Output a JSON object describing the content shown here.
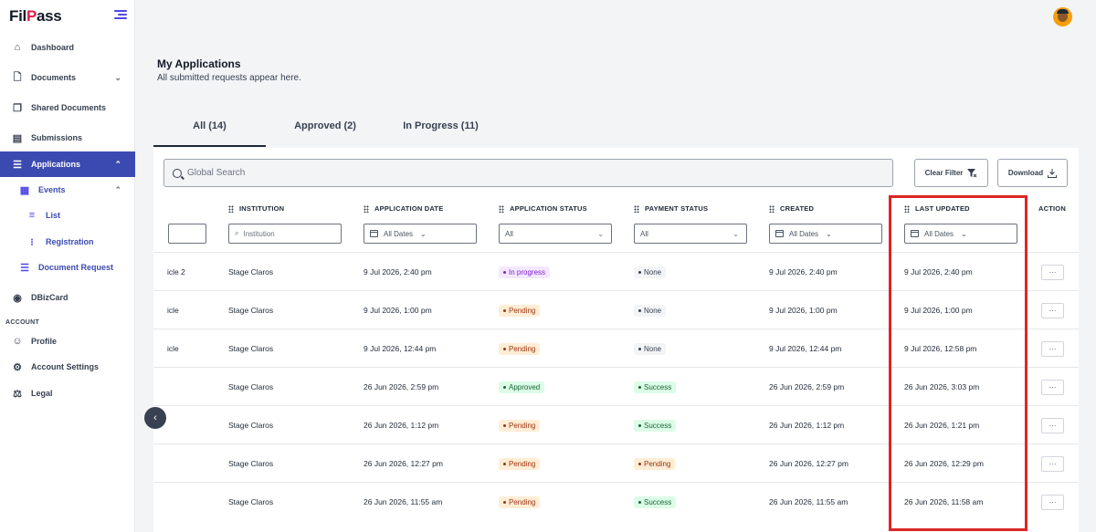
{
  "brand": {
    "logo_prefix": "Fil",
    "logo_accent": "P",
    "logo_suffix": "ass"
  },
  "sidebar": {
    "items": [
      {
        "label": "Dashboard",
        "icon": "home-icon"
      },
      {
        "label": "Documents",
        "icon": "document-icon"
      },
      {
        "label": "Shared Documents",
        "icon": "shared-documents-icon"
      },
      {
        "label": "Submissions",
        "icon": "submissions-icon"
      },
      {
        "label": "Applications",
        "icon": "list-ordered-icon"
      },
      {
        "label": "Events",
        "icon": "calendar-icon"
      },
      {
        "label": "List",
        "icon": "list-icon"
      },
      {
        "label": "Registration",
        "icon": "registration-icon"
      },
      {
        "label": "Document Request",
        "icon": "list-ordered-icon"
      },
      {
        "label": "DBizCard",
        "icon": "palette-icon"
      }
    ],
    "section_label": "ACCOUNT",
    "account_items": [
      {
        "label": "Profile",
        "icon": "user-icon"
      },
      {
        "label": "Account Settings",
        "icon": "gear-icon"
      },
      {
        "label": "Legal",
        "icon": "scale-icon"
      }
    ]
  },
  "page": {
    "title": "My Applications",
    "subtitle": "All submitted requests appear here."
  },
  "tabs": [
    {
      "label": "All (14)"
    },
    {
      "label": "Approved (2)"
    },
    {
      "label": "In Progress (11)"
    }
  ],
  "toolbar": {
    "search_placeholder": "Global Search",
    "clear_filter_label": "Clear Filter",
    "download_label": "Download"
  },
  "table": {
    "columns": {
      "institution": "INSTITUTION",
      "application_date": "APPLICATION DATE",
      "application_status": "APPLICATION STATUS",
      "payment_status": "PAYMENT STATUS",
      "created": "CREATED",
      "last_updated": "LAST UPDATED",
      "action": "ACTION"
    },
    "filters": {
      "institution_placeholder": "Institution",
      "application_date": "All Dates",
      "application_status": "All",
      "payment_status": "All",
      "created": "All Dates",
      "last_updated": "All Dates"
    },
    "rows": [
      {
        "name": "icle 2",
        "institution": "Stage Claros",
        "application_date": "9 Jul 2026, 2:40 pm",
        "app_status": "In progress",
        "app_status_type": "progress",
        "payment": "None",
        "payment_type": "none",
        "created": "9 Jul 2026, 2:40 pm",
        "last_updated": "9 Jul 2026, 2:40 pm",
        "action": "···"
      },
      {
        "name": "icle",
        "institution": "Stage Claros",
        "application_date": "9 Jul 2026, 1:00 pm",
        "app_status": "Pending",
        "app_status_type": "pending",
        "payment": "None",
        "payment_type": "none",
        "created": "9 Jul 2026, 1:00 pm",
        "last_updated": "9 Jul 2026, 1:00 pm",
        "action": "···"
      },
      {
        "name": "icle",
        "institution": "Stage Claros",
        "application_date": "9 Jul 2026, 12:44 pm",
        "app_status": "Pending",
        "app_status_type": "pending",
        "payment": "None",
        "payment_type": "none",
        "created": "9 Jul 2026, 12:44 pm",
        "last_updated": "9 Jul 2026, 12:58 pm",
        "action": "···"
      },
      {
        "name": "",
        "institution": "Stage Claros",
        "application_date": "26 Jun 2026, 2:59 pm",
        "app_status": "Approved",
        "app_status_type": "success",
        "payment": "Success",
        "payment_type": "success",
        "created": "26 Jun 2026, 2:59 pm",
        "last_updated": "26 Jun 2026, 3:03 pm",
        "action": "···"
      },
      {
        "name": "",
        "institution": "Stage Claros",
        "application_date": "26 Jun 2026, 1:12 pm",
        "app_status": "Pending",
        "app_status_type": "pending",
        "payment": "Success",
        "payment_type": "success",
        "created": "26 Jun 2026, 1:12 pm",
        "last_updated": "26 Jun 2026, 1:21 pm",
        "action": "···"
      },
      {
        "name": "",
        "institution": "Stage Claros",
        "application_date": "26 Jun 2026, 12:27 pm",
        "app_status": "Pending",
        "app_status_type": "pending",
        "payment": "Pending",
        "payment_type": "pending",
        "created": "26 Jun 2026, 12:27 pm",
        "last_updated": "26 Jun 2026, 12:29 pm",
        "action": "···"
      },
      {
        "name": "",
        "institution": "Stage Claros",
        "application_date": "26 Jun 2026, 11:55 am",
        "app_status": "Pending",
        "app_status_type": "pending",
        "payment": "Success",
        "payment_type": "success",
        "created": "26 Jun 2026, 11:55 am",
        "last_updated": "26 Jun 2026, 11:58 am",
        "action": "···"
      }
    ]
  },
  "colors": {
    "accent": "#3b4ab0",
    "highlight": "#dc2626",
    "progress_bg": "#f3e8ff",
    "progress_fg": "#7e22ce",
    "pending_bg": "#ffedd5",
    "pending_fg": "#9a3412",
    "success_bg": "#dcfce7",
    "success_fg": "#166534",
    "none_bg": "#f3f4f6",
    "none_fg": "#374151"
  }
}
